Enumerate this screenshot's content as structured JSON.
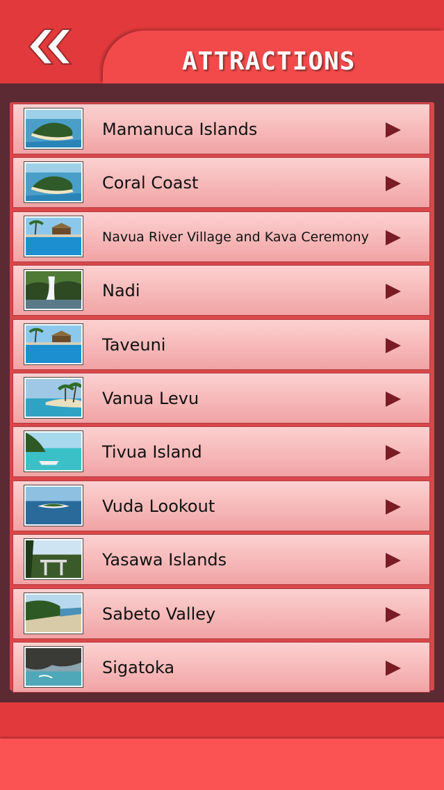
{
  "header": {
    "title": "ATTRACTIONS",
    "back_icon": "double-chevron-left-icon"
  },
  "colors": {
    "header_red": "#e23a3c",
    "panel_maroon": "#5c2a33",
    "row_top": "#fcd1d1",
    "row_bottom": "#f1a3a4",
    "arrow": "#7a1c24"
  },
  "attractions": [
    {
      "label": "Mamanuca Islands",
      "thumb": "island-aerial"
    },
    {
      "label": "Coral Coast",
      "thumb": "island-aerial"
    },
    {
      "label": "Navua River Village and Kava Ceremony",
      "thumb": "resort-pool"
    },
    {
      "label": "Nadi",
      "thumb": "waterfall"
    },
    {
      "label": "Taveuni",
      "thumb": "resort-pool"
    },
    {
      "label": "Vanua Levu",
      "thumb": "beach-palms"
    },
    {
      "label": "Tivua Island",
      "thumb": "beach-boat"
    },
    {
      "label": "Vuda Lookout",
      "thumb": "island-sea"
    },
    {
      "label": "Yasawa Islands",
      "thumb": "lookout-view"
    },
    {
      "label": "Sabeto Valley",
      "thumb": "beach-shore"
    },
    {
      "label": "Sigatoka",
      "thumb": "rocky-coast"
    }
  ]
}
